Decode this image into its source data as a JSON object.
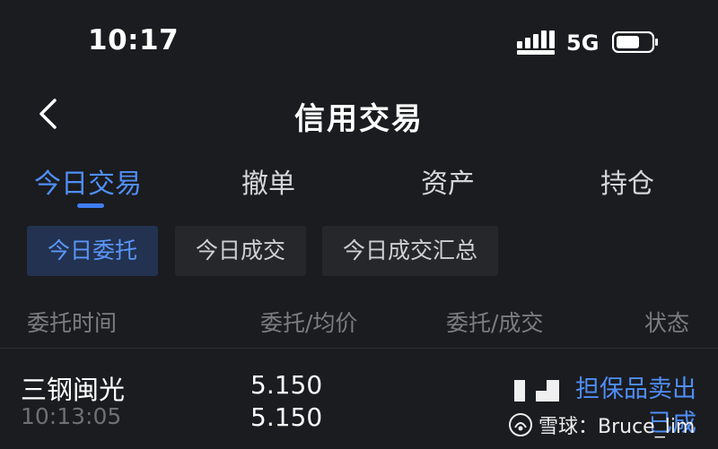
{
  "status_bar": {
    "time": "10:17",
    "network": "5G",
    "icons": [
      "signal-icon",
      "battery-icon"
    ]
  },
  "header": {
    "title": "信用交易",
    "back_icon": "chevron-left-icon"
  },
  "tabs": [
    {
      "label": "今日交易",
      "active": true
    },
    {
      "label": "撤单",
      "active": false
    },
    {
      "label": "资产",
      "active": false
    },
    {
      "label": "持仓",
      "active": false
    }
  ],
  "subtabs": [
    {
      "label": "今日委托",
      "active": true
    },
    {
      "label": "今日成交",
      "active": false
    },
    {
      "label": "今日成交汇总",
      "active": false
    }
  ],
  "columns": {
    "time": "委托时间",
    "price": "委托/均价",
    "qty": "委托/成交",
    "status": "状态"
  },
  "orders": [
    {
      "name": "三钢闽光",
      "time": "10:13:05",
      "order_price": "5.150",
      "avg_price": "5.150",
      "type": "担保品卖出",
      "status": "已成"
    }
  ],
  "watermark": {
    "text": "雪球：Bruce_lim",
    "icon": "snowball-logo-icon"
  },
  "colors": {
    "background": "#1b1c1f",
    "accent": "#4f8ef7",
    "active_chip_bg": "#223250",
    "chip_bg": "#26272b",
    "muted_text": "#7c7c82"
  }
}
